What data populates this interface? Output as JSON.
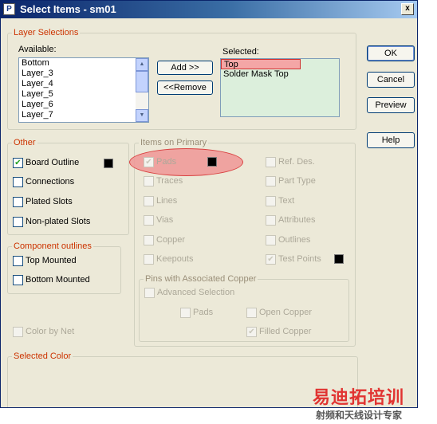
{
  "window": {
    "title": "Select Items - sm01",
    "close_glyph": "x"
  },
  "layer_selections": {
    "legend": "Layer Selections",
    "available_label": "Available:",
    "available_items": [
      "Bottom",
      "Layer_3",
      "Layer_4",
      "Layer_5",
      "Layer_6",
      "Layer_7"
    ],
    "selected_label": "Selected:",
    "selected_items": [
      "Top",
      "Solder Mask Top"
    ],
    "add_button": "Add >>",
    "remove_button": "<<Remove"
  },
  "buttons": {
    "ok": "OK",
    "cancel": "Cancel",
    "preview": "Preview",
    "help": "Help"
  },
  "other": {
    "legend": "Other",
    "items": [
      {
        "label": "Board Outline",
        "checked": true
      },
      {
        "label": "Connections",
        "checked": false
      },
      {
        "label": "Plated Slots",
        "checked": false
      },
      {
        "label": "Non-plated Slots",
        "checked": false
      }
    ]
  },
  "component_outlines": {
    "legend": "Component outlines",
    "items": [
      {
        "label": "Top Mounted",
        "checked": false
      },
      {
        "label": "Bottom Mounted",
        "checked": false
      }
    ]
  },
  "color_by_net": {
    "label": "Color by Net"
  },
  "items_on_primary": {
    "legend": "Items on Primary",
    "left": [
      "Pads",
      "Traces",
      "Lines",
      "Vias",
      "Copper",
      "Keepouts"
    ],
    "right": [
      "Ref. Des.",
      "Part Type",
      "Text",
      "Attributes",
      "Outlines",
      "Test Points"
    ]
  },
  "pins_with_copper": {
    "legend": "Pins with Associated Copper",
    "advanced": "Advanced Selection",
    "pads": "Pads",
    "open_copper": "Open Copper",
    "filled_copper": "Filled Copper"
  },
  "selected_color": {
    "legend": "Selected Color"
  },
  "watermark": {
    "line1": "易迪拓培训",
    "line2": "射频和天线设计专家"
  },
  "colors": {
    "swatch": "#000000",
    "highlight": "#f4a6a6",
    "legend_accent": "#cc3300"
  }
}
